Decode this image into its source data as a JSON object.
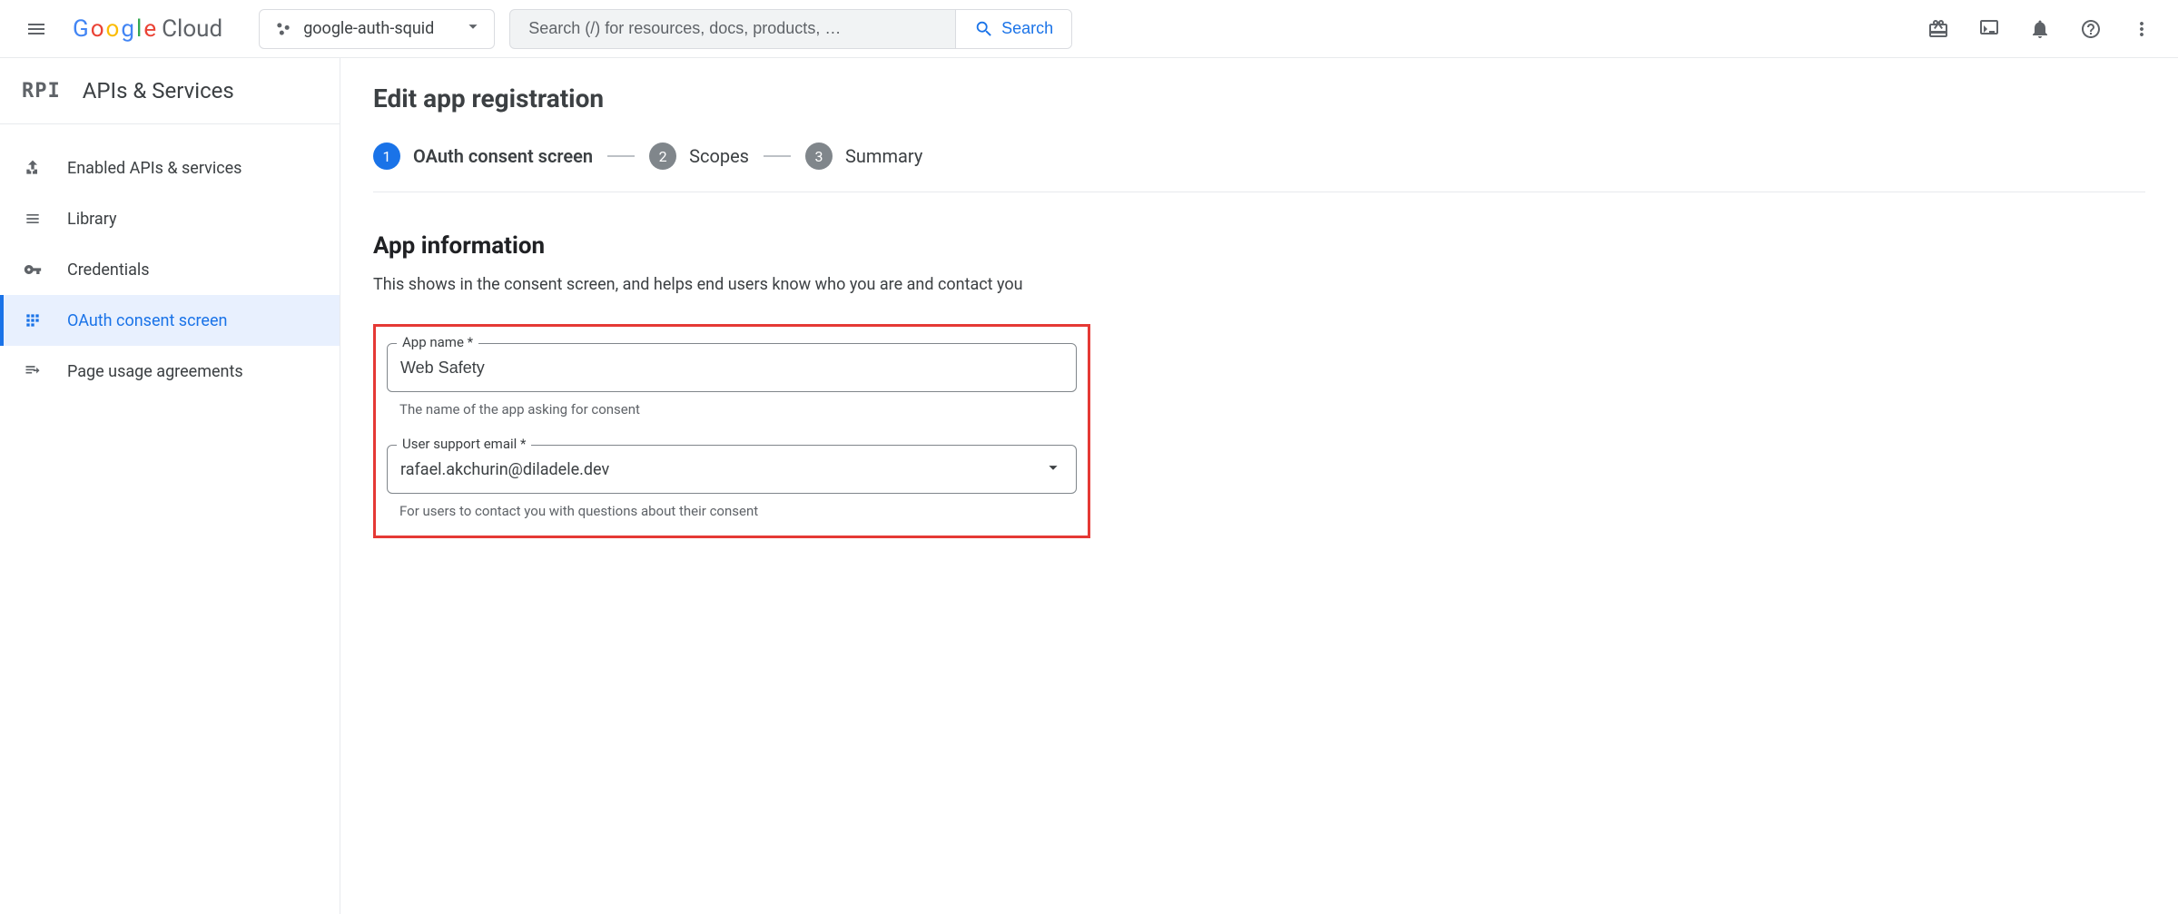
{
  "header": {
    "logo_text_cloud": "Cloud",
    "project_name": "google-auth-squid",
    "search_placeholder": "Search (/) for resources, docs, products, …",
    "search_button_label": "Search"
  },
  "sidebar": {
    "title": "APIs & Services",
    "items": [
      {
        "label": "Enabled APIs & services"
      },
      {
        "label": "Library"
      },
      {
        "label": "Credentials"
      },
      {
        "label": "OAuth consent screen"
      },
      {
        "label": "Page usage agreements"
      }
    ]
  },
  "main": {
    "page_title": "Edit app registration",
    "steps": [
      {
        "num": "1",
        "label": "OAuth consent screen"
      },
      {
        "num": "2",
        "label": "Scopes"
      },
      {
        "num": "3",
        "label": "Summary"
      }
    ],
    "section": {
      "title": "App information",
      "desc": "This shows in the consent screen, and helps end users know who you are and contact you"
    },
    "fields": {
      "app_name": {
        "label": "App name *",
        "value": "Web Safety",
        "helper": "The name of the app asking for consent"
      },
      "support_email": {
        "label": "User support email *",
        "value": "rafael.akchurin@diladele.dev",
        "helper": "For users to contact you with questions about their consent"
      }
    }
  }
}
